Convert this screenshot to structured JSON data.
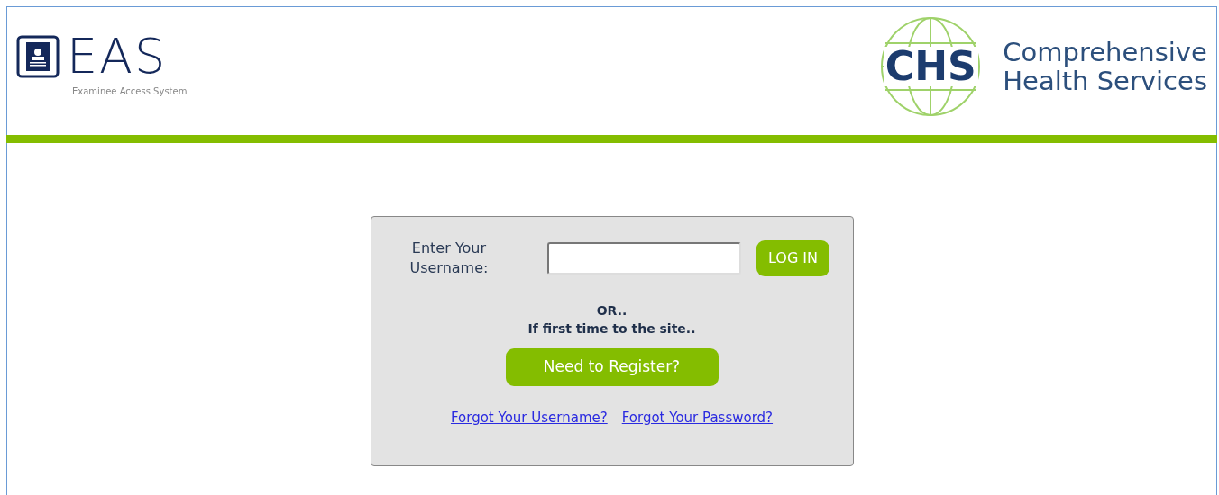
{
  "header": {
    "eas_logo": {
      "wordmark": "EAS",
      "tagline": "Examinee Access System"
    },
    "chs_logo": {
      "mark": "CHS",
      "name_line_1": "Comprehensive",
      "name_line_2": "Health Services"
    }
  },
  "login": {
    "username_label": "Enter Your Username:",
    "login_button": "LOG IN",
    "or_text": "OR..",
    "first_time_text": "If first time to the site..",
    "register_button": "Need to Register?",
    "links": [
      "Forgot Your Username?",
      "Forgot Your Password?"
    ]
  }
}
